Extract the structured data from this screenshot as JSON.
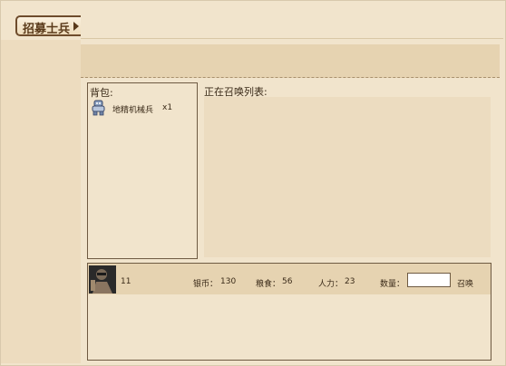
{
  "title": {
    "label": "招募士兵",
    "arrow_icon": "triangle-right-icon"
  },
  "bag": {
    "title": "背包:",
    "items": [
      {
        "name": "地精机械兵",
        "count": "x1",
        "icon": "mech-robot-icon"
      }
    ]
  },
  "summoning": {
    "label": "正在召唤列表:"
  },
  "unit": {
    "portrait": "soldier-avatar",
    "count": "11",
    "silver_label": "银币：",
    "silver": "130",
    "food_label": "粮食：",
    "food": "56",
    "manpower_label": "人力：",
    "manpower": "23",
    "quantity_label": "数量：",
    "quantity_value": "",
    "summon_button": "召唤"
  },
  "colors": {
    "background": "#f1e4cc",
    "band": "#e6d3b1",
    "border": "#6e5a42",
    "title_text": "#5a3a1a"
  }
}
